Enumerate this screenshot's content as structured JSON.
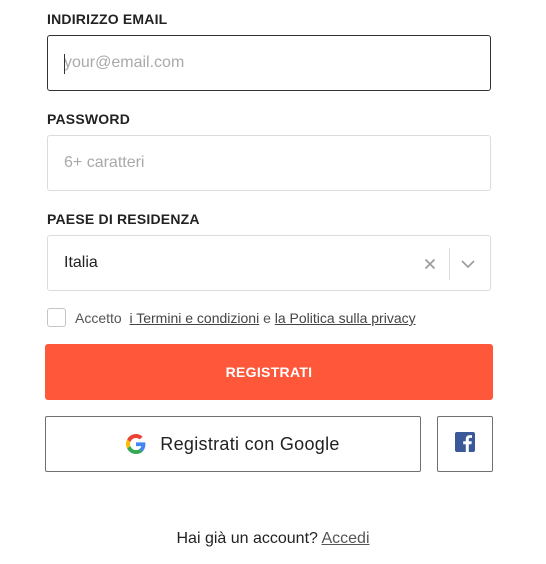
{
  "email": {
    "label": "INDIRIZZO EMAIL",
    "placeholder": "your@email.com",
    "value": ""
  },
  "password": {
    "label": "PASSWORD",
    "placeholder": "6+ caratteri",
    "value": ""
  },
  "country": {
    "label": "PAESE DI RESIDENZA",
    "selected": "Italia",
    "clear_icon": "close-icon",
    "dropdown_icon": "chevron-down-icon"
  },
  "terms": {
    "checked": false,
    "prefix": "Accetto",
    "terms_link": "i Termini e condizioni",
    "connector": "e",
    "privacy_link": "la Politica sulla privacy"
  },
  "register_button": {
    "label": "REGISTRATI",
    "color": "#ff573a"
  },
  "google_button": {
    "label": "Registrati con Google",
    "icon": "google-icon"
  },
  "facebook_button": {
    "icon": "facebook-icon",
    "color": "#3b5998"
  },
  "login_prompt": {
    "text": "Hai già un account?",
    "link": "Accedi"
  }
}
